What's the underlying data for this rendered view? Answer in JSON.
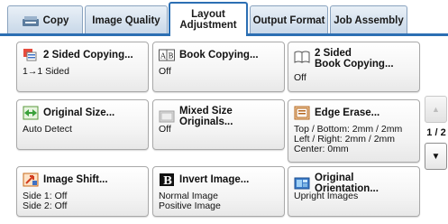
{
  "tabs": [
    {
      "label": "Copy"
    },
    {
      "label": "Image Quality"
    },
    {
      "label": "Layout\nAdjustment",
      "active": true
    },
    {
      "label": "Output Format"
    },
    {
      "label": "Job Assembly"
    }
  ],
  "buttons": [
    {
      "title": "2 Sided Copying...",
      "value": "1→1 Sided",
      "icon": "two-sided-icon"
    },
    {
      "title": "Book Copying...",
      "value": "Off",
      "icon": "book-ab-icon"
    },
    {
      "title": "2 Sided\nBook Copying...",
      "value": "Off",
      "icon": "open-book-icon"
    },
    {
      "title": "Original Size...",
      "value": "Auto Detect",
      "icon": "original-size-icon"
    },
    {
      "title": "Mixed Size Originals...",
      "value": "Off",
      "icon": "mixed-size-icon"
    },
    {
      "title": "Edge Erase...",
      "value": "Top / Bottom: 2mm / 2mm\nLeft / Right: 2mm / 2mm\nCenter: 0mm",
      "icon": "edge-erase-icon"
    },
    {
      "title": "Image Shift...",
      "value": "Side 1: Off\nSide 2: Off",
      "icon": "image-shift-icon"
    },
    {
      "title": "Invert Image...",
      "value": "Normal Image\nPositive Image",
      "icon": "invert-image-icon"
    },
    {
      "title": "Original Orientation...",
      "value": "Upright Images",
      "icon": "original-orientation-icon"
    }
  ],
  "pager": {
    "page": "1 / 2",
    "up_icon": "arrow-up-icon",
    "down_icon": "arrow-down-icon"
  },
  "colors": {
    "accent": "#2c6fb3",
    "tab_inactive": "#d3e0ee"
  }
}
